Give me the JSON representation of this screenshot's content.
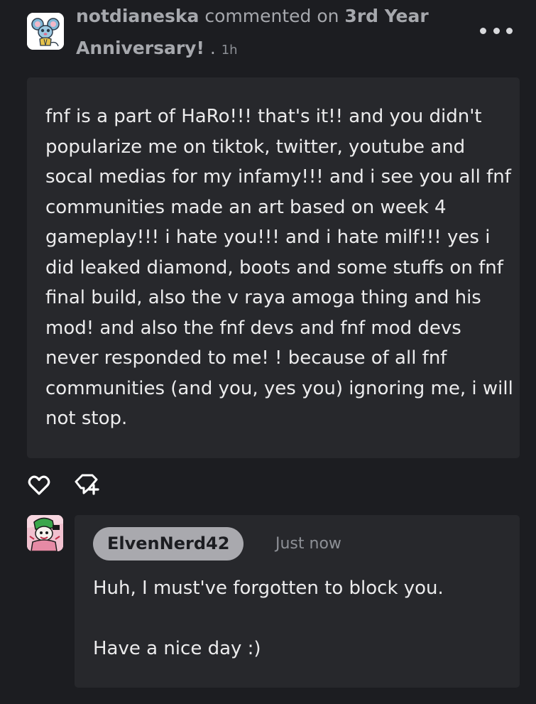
{
  "header": {
    "username": "notdianeska",
    "action_text": "commented on",
    "post_title_part1": "3rd Year",
    "post_title_part2": "Anniversary!",
    "separator": " . ",
    "time": "1h",
    "more_icon": "more-horizontal-icon"
  },
  "comment": {
    "text": "fnf is a part of HaRo!!! that's it!! and you didn't popularize me on tiktok, twitter, youtube and socal medias for my infamy!!! and i see you all fnf communities made an art based on week 4 gameplay!!! i hate you!!! and i hate milf!!! yes i did leaked diamond, boots and some stuffs on fnf final build, also the v raya amoga thing and his mod! and also the fnf devs and fnf mod devs never responded to me! ! because of all fnf communities (and you, yes you) ignoring me, i will not stop."
  },
  "actions": {
    "like_icon": "heart-icon",
    "reply_icon": "reply-icon"
  },
  "reply": {
    "username": "ElvenNerd42",
    "time": "Just now",
    "line1": "Huh, I must've forgotten to block you.",
    "line2": "Have a nice day :)"
  },
  "colors": {
    "background": "#1c1d21",
    "card": "#27282c",
    "text": "#ececed",
    "muted": "#a6a8ad",
    "username_pill": "#a9a9ae"
  }
}
